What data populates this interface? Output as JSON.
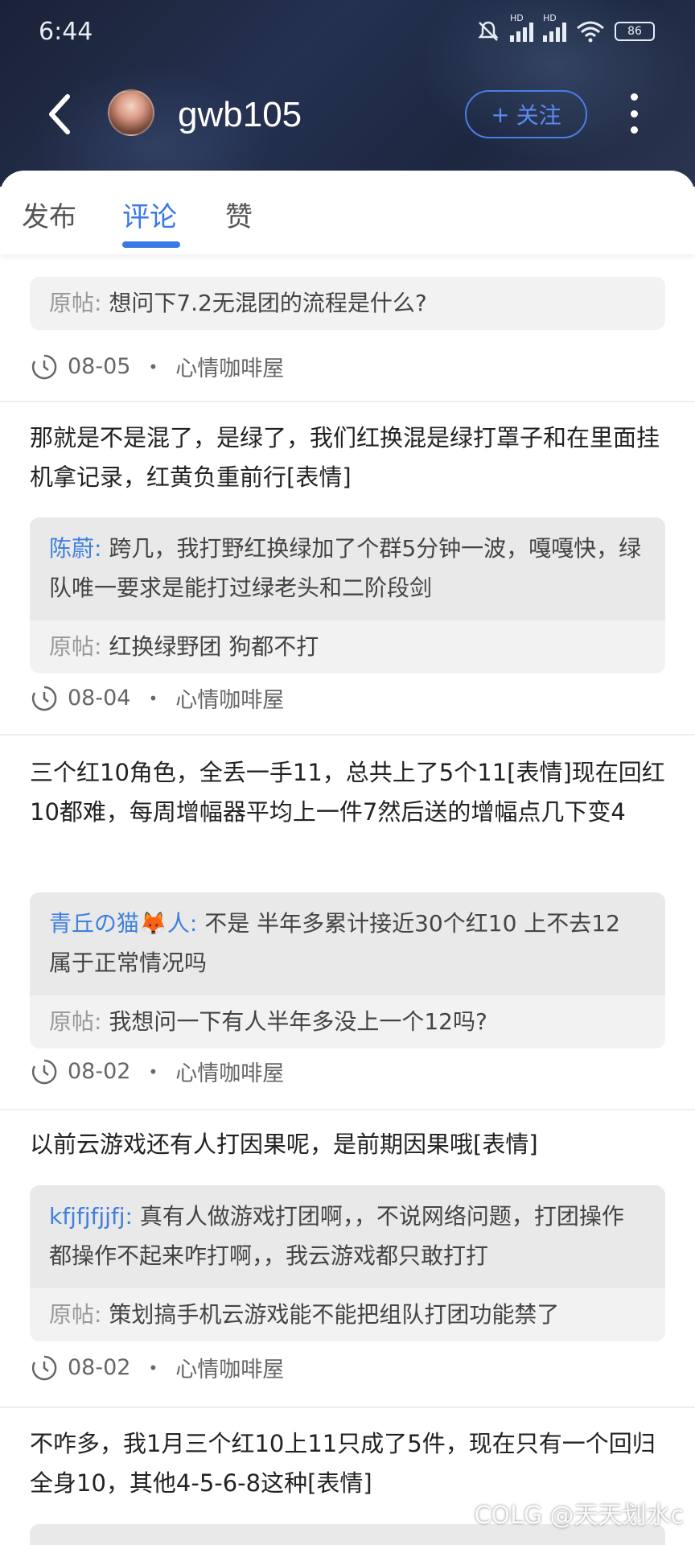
{
  "status_bar": {
    "time": "6:44",
    "hd1": "HD",
    "hd2": "HD",
    "battery": "86"
  },
  "header": {
    "username": "gwb105",
    "follow_plus": "+",
    "follow_label": "关注"
  },
  "tabs": [
    {
      "label": "发布"
    },
    {
      "label": "评论"
    },
    {
      "label": "赞"
    }
  ],
  "posts": [
    {
      "orig_label": "原帖:",
      "orig": "想问下7.2无混团的流程是什么?",
      "date": "08-05",
      "board": "心情咖啡屋"
    },
    {
      "text": "那就是不是混了，是绿了，我们红换混是绿打罩子和在里面挂机拿记录，红黄负重前行[表情]",
      "reply_user": "陈蔚:",
      "reply_text": "跨几，我打野红换绿加了个群5分钟一波，嘎嘎快，绿队唯一要求是能打过绿老头和二阶段剑",
      "orig_label": "原帖:",
      "orig": "红换绿野团 狗都不打",
      "date": "08-04",
      "board": "心情咖啡屋"
    },
    {
      "text": "三个红10角色，全丢一手11，总共上了5个11[表情]现在回红10都难，每周增幅器平均上一件7然后送的增幅点几下变4",
      "reply_user": "青丘の猫🦊人:",
      "reply_text": "不是 半年多累计接近30个红10 上不去12 属于正常情况吗",
      "orig_label": "原帖:",
      "orig": "我想问一下有人半年多没上一个12吗?",
      "date": "08-02",
      "board": "心情咖啡屋"
    },
    {
      "text": "以前云游戏还有人打因果呢，是前期因果哦[表情]",
      "reply_user": "kfjfjfjjfj:",
      "reply_text": "真有人做游戏打团啊，，不说网络问题，打团操作都操作不起来咋打啊，，我云游戏都只敢打打",
      "orig_label": "原帖:",
      "orig": "策划搞手机云游戏能不能把组队打团功能禁了",
      "date": "08-02",
      "board": "心情咖啡屋"
    },
    {
      "text": "不咋多，我1月三个红10上11只成了5件，现在只有一个回归全身10，其他4-5-6-8这种[表情]"
    }
  ],
  "watermark": "COLG @天天划水c"
}
